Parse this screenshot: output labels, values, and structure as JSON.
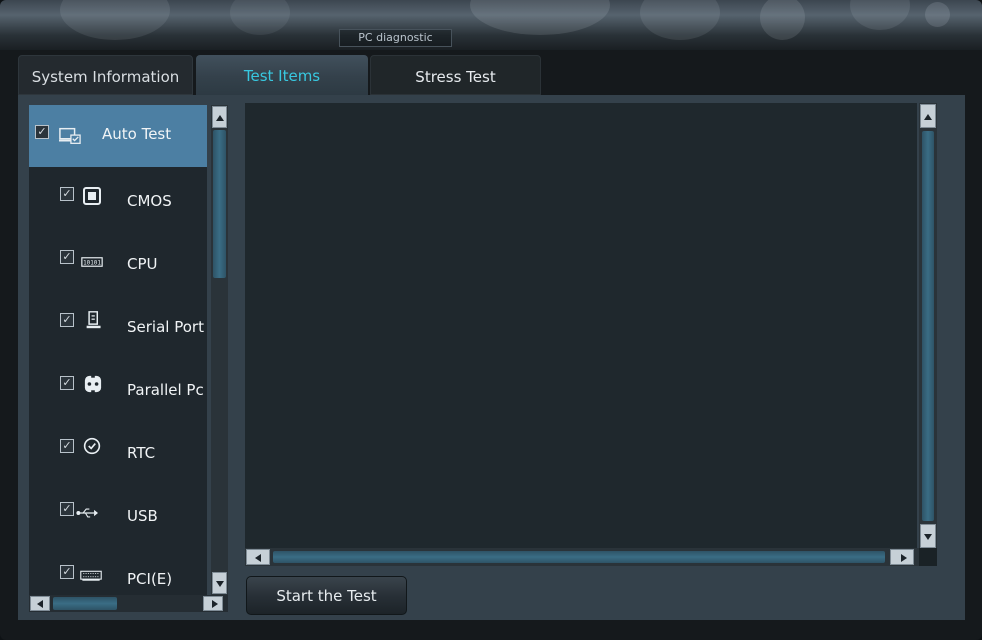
{
  "window": {
    "title": "PC diagnostic"
  },
  "tabs": [
    {
      "label": "System Information",
      "active": false
    },
    {
      "label": "Test Items",
      "active": true
    },
    {
      "label": "Stress Test",
      "active": false
    }
  ],
  "tree": {
    "items": [
      {
        "label": "Auto Test",
        "checked": true,
        "icon": "monitor-check-icon",
        "selected": true
      },
      {
        "label": "CMOS",
        "checked": true,
        "icon": "chip-square-icon"
      },
      {
        "label": "CPU",
        "checked": true,
        "icon": "cpu-bits-icon"
      },
      {
        "label": "Serial Port",
        "checked": true,
        "icon": "serial-port-icon"
      },
      {
        "label": "Parallel Pc",
        "checked": true,
        "icon": "parallel-port-icon"
      },
      {
        "label": "RTC",
        "checked": true,
        "icon": "clock-check-icon"
      },
      {
        "label": "USB",
        "checked": true,
        "icon": "usb-icon"
      },
      {
        "label": "PCI(E)",
        "checked": true,
        "icon": "pci-card-icon"
      }
    ]
  },
  "actions": {
    "start_label": "Start the Test"
  },
  "colors": {
    "accent": "#38c8e0",
    "selection": "#4c7fa3",
    "panel": "#34414b",
    "background": "#15191c"
  }
}
